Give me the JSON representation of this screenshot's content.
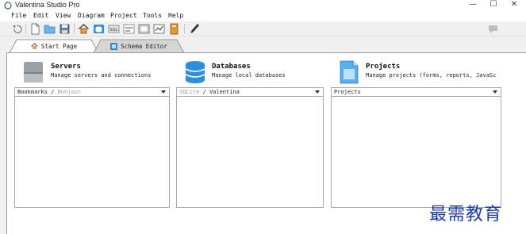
{
  "window": {
    "title": "Valentina Studio Pro",
    "controls": {
      "minimize": "—",
      "maximize": "☐",
      "close": "✕"
    }
  },
  "menu": [
    "File",
    "Edit",
    "View",
    "Diagram",
    "Project",
    "Tools",
    "Help"
  ],
  "toolbar": {
    "icons": [
      "undo-icon",
      "new-file-icon",
      "open-folder-icon",
      "save-icon",
      "home-icon",
      "database-connect-icon",
      "sql-editor-icon",
      "form-icon",
      "report-icon",
      "diagram-icon",
      "book-icon",
      "pen-icon",
      "chat-icon"
    ]
  },
  "tabs": [
    {
      "label": "Start Page",
      "icon": "home-icon",
      "active": true
    },
    {
      "label": "Schema Editor",
      "icon": "schema-icon",
      "active": false
    }
  ],
  "cards": {
    "servers": {
      "title": "Servers",
      "description": "Manage servers and connections",
      "dropdown": {
        "primary": "Bookmarks",
        "separator": " / ",
        "secondary": "Bonjour"
      }
    },
    "databases": {
      "title": "Databases",
      "description": "Manage local databases",
      "dropdown": {
        "primary": "SQLite",
        "separator": " / ",
        "secondary": "Valentina"
      }
    },
    "projects": {
      "title": "Projects",
      "description": "Manage projects (forms, reports, JavaSc",
      "dropdown": {
        "primary": "Projects"
      }
    }
  },
  "watermark": "最需教育",
  "colors": {
    "accent_blue": "#2a8fe0",
    "watermark": "#1a3aa8",
    "chrome": "#f0f0f0"
  }
}
